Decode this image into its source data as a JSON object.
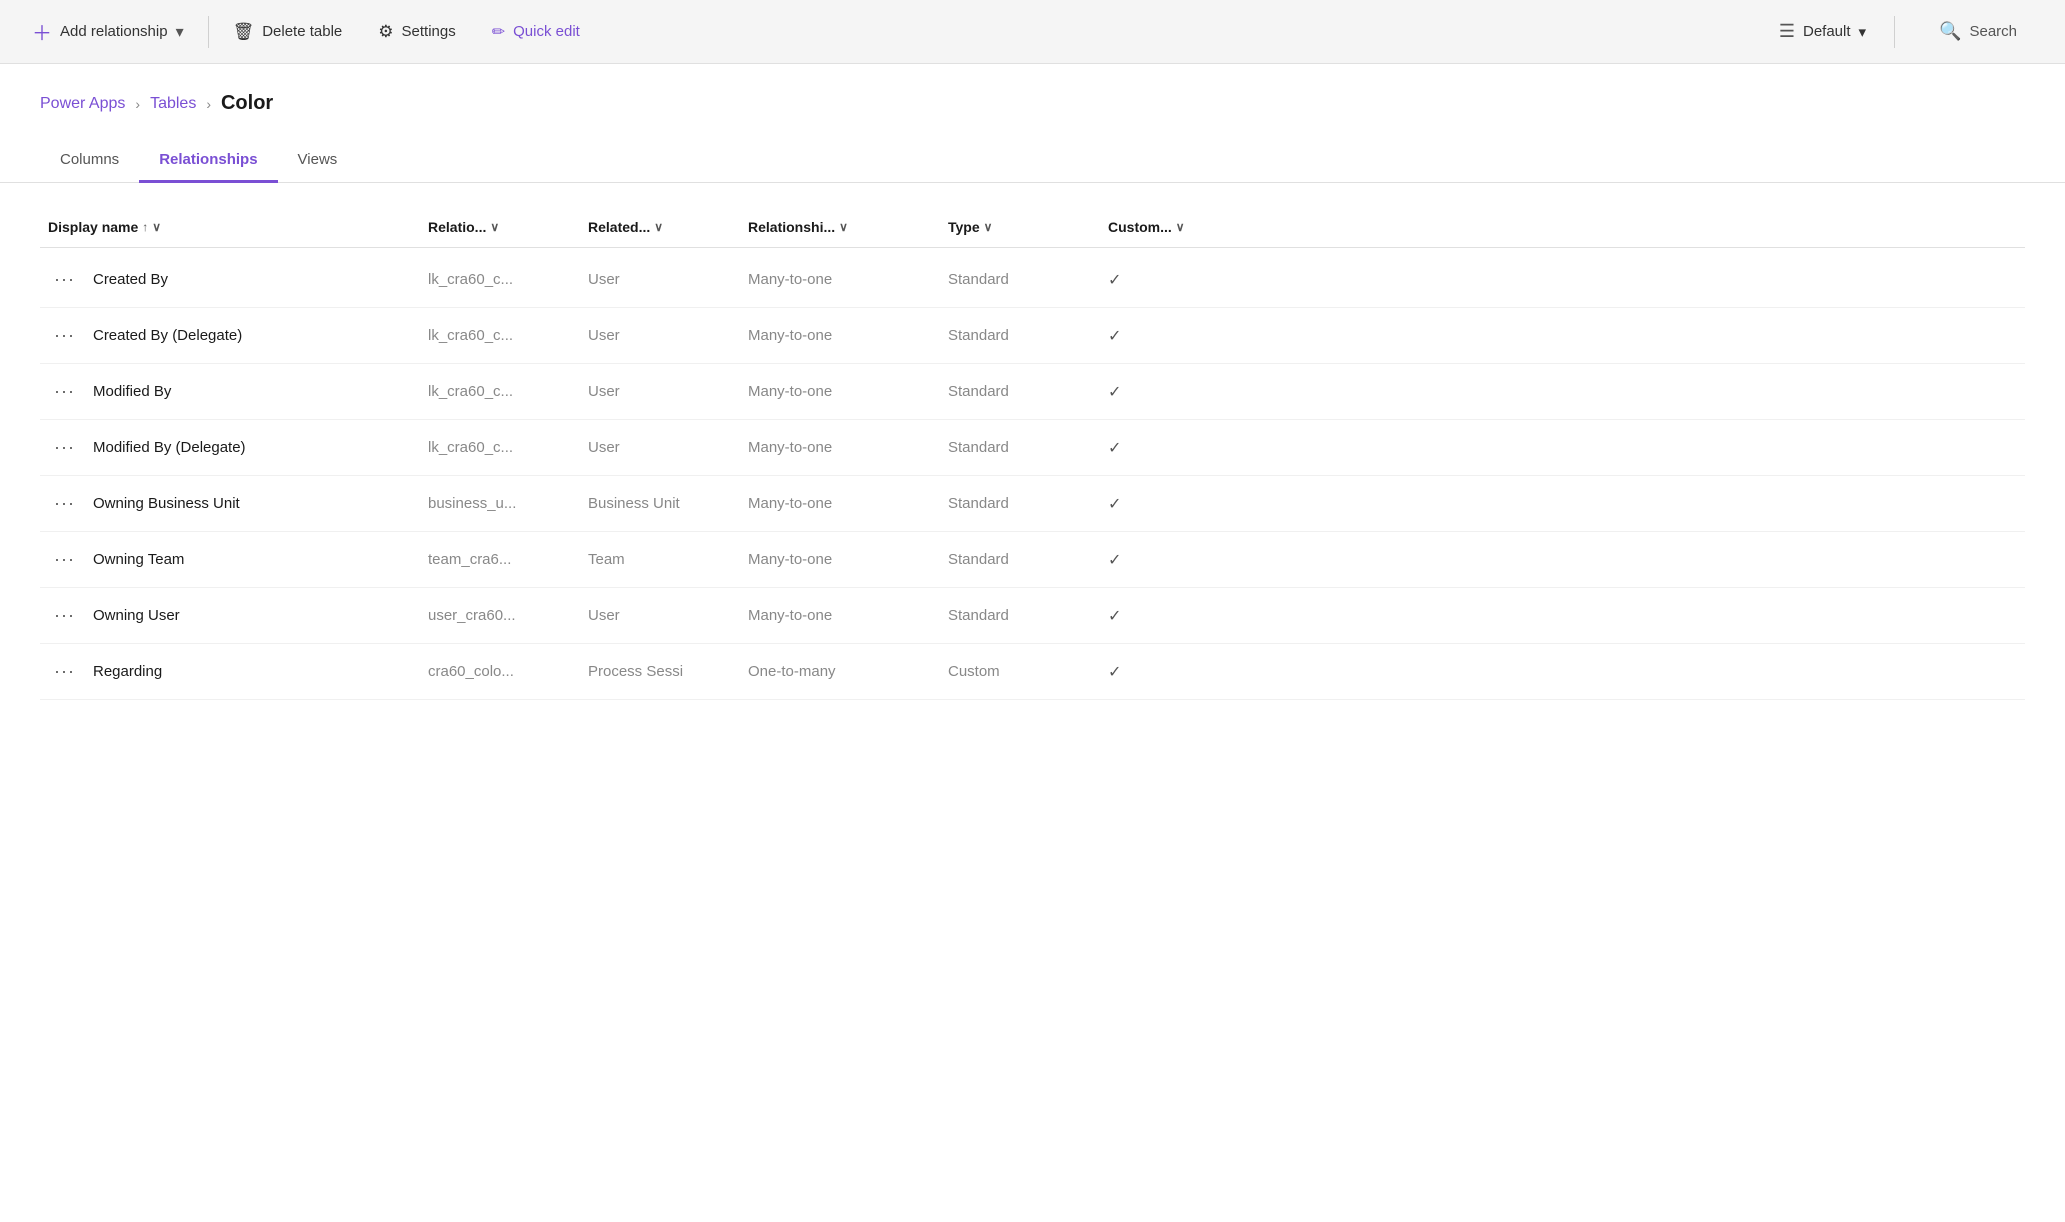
{
  "toolbar": {
    "add_label": "Add relationship",
    "add_dropdown_icon": "▾",
    "delete_label": "Delete table",
    "settings_label": "Settings",
    "quick_edit_label": "Quick edit",
    "default_label": "Default",
    "default_dropdown_icon": "▾",
    "search_label": "Search"
  },
  "breadcrumb": {
    "power_apps": "Power Apps",
    "sep1": "›",
    "tables": "Tables",
    "sep2": "›",
    "current": "Color"
  },
  "tabs": [
    {
      "label": "Columns",
      "active": false
    },
    {
      "label": "Relationships",
      "active": true
    },
    {
      "label": "Views",
      "active": false
    }
  ],
  "table": {
    "columns": [
      {
        "label": "Display name",
        "sort": "↑",
        "chevron": "∨"
      },
      {
        "label": "Relatio...",
        "chevron": "∨"
      },
      {
        "label": "Related...",
        "chevron": "∨"
      },
      {
        "label": "Relationshi...",
        "chevron": "∨"
      },
      {
        "label": "Type",
        "chevron": "∨"
      },
      {
        "label": "Custom...",
        "chevron": "∨"
      }
    ],
    "rows": [
      {
        "display_name": "Created By",
        "relationship": "lk_cra60_c...",
        "related": "User",
        "relationship_type": "Many-to-one",
        "type": "Standard",
        "custom": "✓"
      },
      {
        "display_name": "Created By (Delegate)",
        "relationship": "lk_cra60_c...",
        "related": "User",
        "relationship_type": "Many-to-one",
        "type": "Standard",
        "custom": "✓"
      },
      {
        "display_name": "Modified By",
        "relationship": "lk_cra60_c...",
        "related": "User",
        "relationship_type": "Many-to-one",
        "type": "Standard",
        "custom": "✓"
      },
      {
        "display_name": "Modified By (Delegate)",
        "relationship": "lk_cra60_c...",
        "related": "User",
        "relationship_type": "Many-to-one",
        "type": "Standard",
        "custom": "✓"
      },
      {
        "display_name": "Owning Business Unit",
        "relationship": "business_u...",
        "related": "Business Unit",
        "relationship_type": "Many-to-one",
        "type": "Standard",
        "custom": "✓"
      },
      {
        "display_name": "Owning Team",
        "relationship": "team_cra6...",
        "related": "Team",
        "relationship_type": "Many-to-one",
        "type": "Standard",
        "custom": "✓"
      },
      {
        "display_name": "Owning User",
        "relationship": "user_cra60...",
        "related": "User",
        "relationship_type": "Many-to-one",
        "type": "Standard",
        "custom": "✓"
      },
      {
        "display_name": "Regarding",
        "relationship": "cra60_colo...",
        "related": "Process Sessi",
        "relationship_type": "One-to-many",
        "type": "Custom",
        "custom": "✓"
      }
    ]
  }
}
